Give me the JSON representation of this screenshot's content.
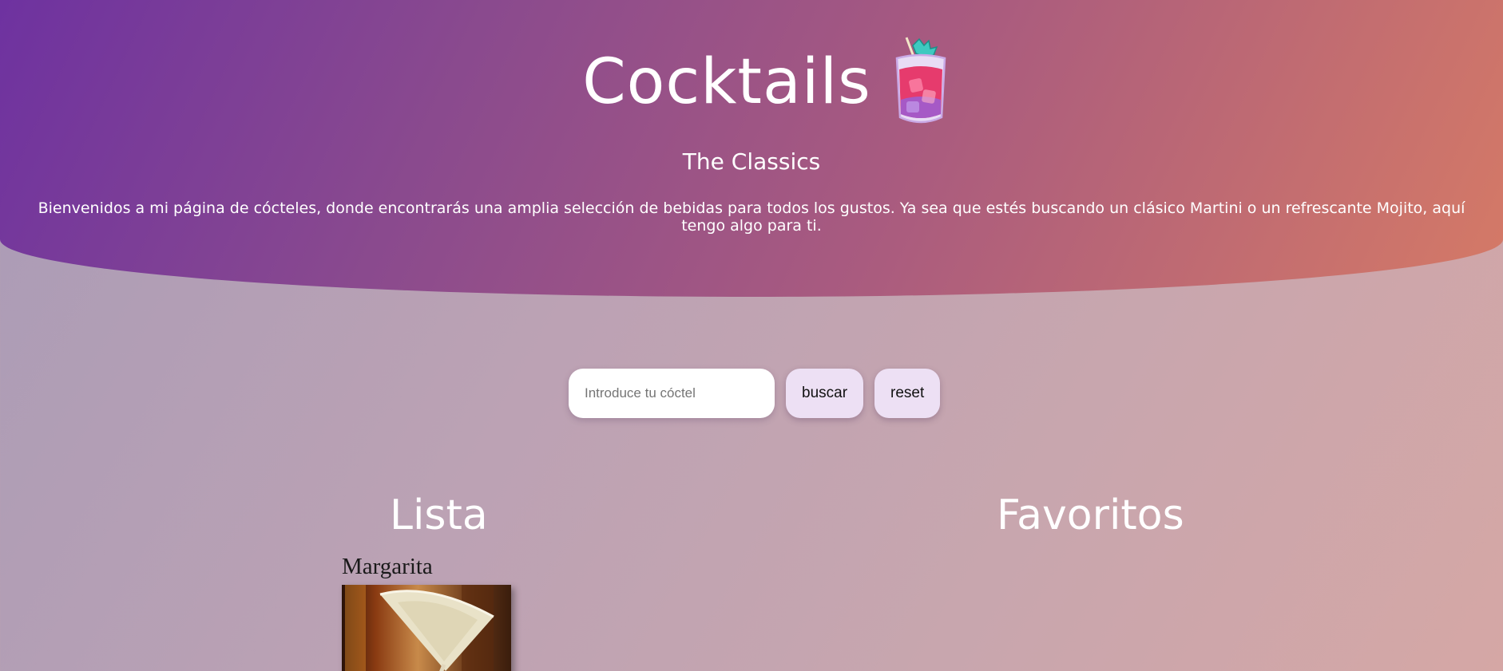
{
  "header": {
    "title": "Cocktails",
    "subtitle": "The Classics",
    "intro": "Bienvenidos a mi página de cócteles, donde encontrarás una amplia selección de bebidas para todos los gustos. Ya sea que estés buscando un clásico Martini o un refrescante Mojito, aquí tengo algo para ti."
  },
  "search": {
    "value": "",
    "placeholder": "Introduce tu cóctel",
    "search_label": "buscar",
    "reset_label": "reset"
  },
  "sections": {
    "list_heading": "Lista",
    "favorites_heading": "Favoritos"
  },
  "list": {
    "items": [
      {
        "name": "Margarita"
      }
    ]
  },
  "colors": {
    "header_gradient_start": "#6e32a0",
    "header_gradient_end": "#d57a66",
    "button_bg": "#ede0f4"
  }
}
